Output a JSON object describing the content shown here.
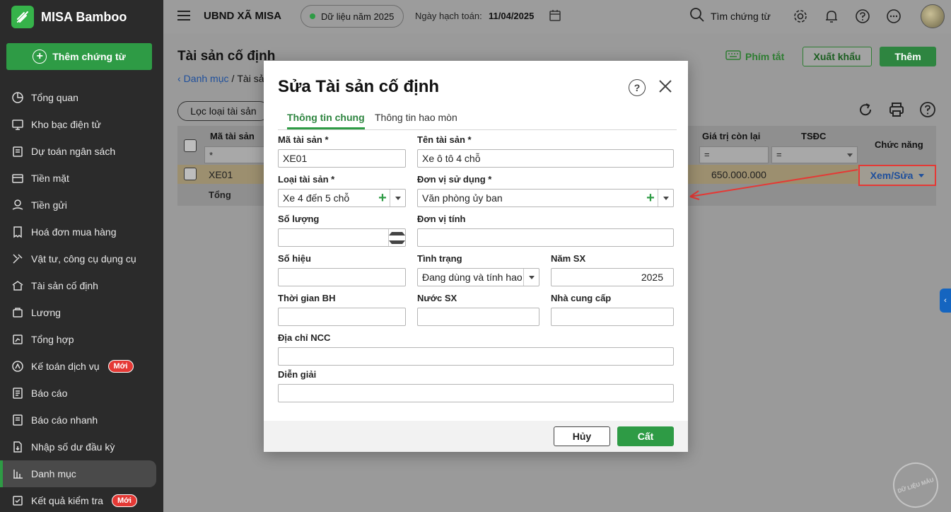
{
  "app": {
    "name": "MISA Bamboo"
  },
  "sidebar": {
    "add_voucher_label": "Thêm chứng từ",
    "items": [
      {
        "label": "Tổng quan",
        "icon": "pie-chart-icon"
      },
      {
        "label": "Kho bạc điện tử",
        "icon": "monitor-icon"
      },
      {
        "label": "Dự toán ngân sách",
        "icon": "budget-icon"
      },
      {
        "label": "Tiền mặt",
        "icon": "cash-icon"
      },
      {
        "label": "Tiền gửi",
        "icon": "deposit-icon"
      },
      {
        "label": "Hoá đơn mua hàng",
        "icon": "invoice-icon"
      },
      {
        "label": "Vật tư, công cụ dụng cụ",
        "icon": "tools-icon"
      },
      {
        "label": "Tài sản cố định",
        "icon": "building-icon"
      },
      {
        "label": "Lương",
        "icon": "salary-icon"
      },
      {
        "label": "Tổng hợp",
        "icon": "summary-icon"
      },
      {
        "label": "Kế toán dịch vụ",
        "icon": "service-icon",
        "badge": "Mới"
      },
      {
        "label": "Báo cáo",
        "icon": "report-icon"
      },
      {
        "label": "Báo cáo nhanh",
        "icon": "quick-report-icon"
      },
      {
        "label": "Nhập số dư đầu kỳ",
        "icon": "opening-balance-icon"
      },
      {
        "label": "Danh mục",
        "icon": "category-icon",
        "active": true
      },
      {
        "label": "Kết quả kiểm tra",
        "icon": "check-result-icon",
        "badge": "Mới"
      }
    ]
  },
  "header": {
    "org_name": "UBND XÃ MISA",
    "data_year": "Dữ liệu năm 2025",
    "accounting_date_label": "Ngày hạch toán:",
    "accounting_date": "11/04/2025",
    "search_label": "Tìm chứng từ"
  },
  "page": {
    "title": "Tài sản cố định",
    "breadcrumb_link": "Danh mục",
    "breadcrumb_sep": "/",
    "breadcrumb_current": "Tài sả",
    "shortcut_label": "Phím tắt",
    "export_label": "Xuất khẩu",
    "add_label": "Thêm",
    "filter_label": "Lọc loại tài sản"
  },
  "grid": {
    "col_code": "Mã tài sản",
    "col_remaining": "Giá trị còn lại",
    "col_tsdc": "TSĐC",
    "col_function": "Chức năng",
    "filter_star": "*",
    "filter_eq": "=",
    "row_code": "XE01",
    "row_remaining": "650.000.000",
    "row_action": "Xem/Sửa",
    "total_label": "Tổng"
  },
  "dialog": {
    "title": "Sửa Tài sản cố định",
    "tabs": [
      "Thông tin chung",
      "Thông tin hao mòn"
    ],
    "fields": {
      "asset_code": {
        "label": "Mã tài sản *",
        "value": "XE01"
      },
      "asset_name": {
        "label": "Tên tài sản *",
        "value": "Xe ô tô 4 chỗ"
      },
      "asset_type": {
        "label": "Loại tài sản *",
        "value": "Xe 4 đến 5 chỗ"
      },
      "using_unit": {
        "label": "Đơn vị sử dụng *",
        "value": "Văn phòng ủy ban"
      },
      "quantity": {
        "label": "Số lượng",
        "value": ""
      },
      "unit": {
        "label": "Đơn vị tính",
        "value": ""
      },
      "serial": {
        "label": "Số hiệu",
        "value": ""
      },
      "status": {
        "label": "Tình trạng",
        "value": "Đang dùng và tính hao"
      },
      "year": {
        "label": "Năm SX",
        "value": "2025"
      },
      "warranty": {
        "label": "Thời gian BH",
        "value": ""
      },
      "country": {
        "label": "Nước SX",
        "value": ""
      },
      "supplier": {
        "label": "Nhà cung cấp",
        "value": ""
      },
      "supplier_address": {
        "label": "Địa chỉ NCC",
        "value": ""
      },
      "description": {
        "label": "Diễn giải",
        "value": ""
      }
    },
    "cancel_label": "Hủy",
    "save_label": "Cất"
  },
  "watermark": "DỮ LIỆU MẪU",
  "colors": {
    "accent": "#2e9b45",
    "link": "#1e4f9c",
    "highlight": "#e53935"
  }
}
